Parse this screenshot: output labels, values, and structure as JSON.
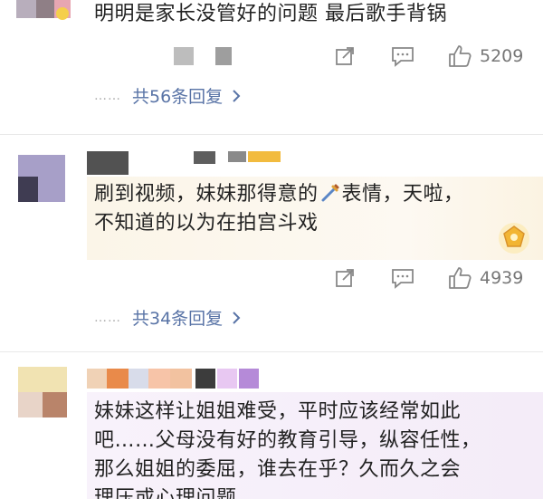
{
  "comments": [
    {
      "text_lines": [
        "明明是家长没管好的问题 最后歌手背锅"
      ],
      "like_count": "5209",
      "replies_label": "共56条回复",
      "replies_dots": "……"
    },
    {
      "text_lines": [
        "刷到视频，妹妹那得意的",
        "表情，天啦，",
        "不知道的以为在拍宫斗戏"
      ],
      "like_count": "4939",
      "replies_label": "共34条回复",
      "replies_dots": "……"
    },
    {
      "text_lines": [
        "妹妹这样让姐姐难受，平时应该经常如此",
        "吧……父母没有好的教育引导，纵容任性，",
        "那么姐姐的委屈，谁去在乎？久而久之会",
        "理压或心理问题……"
      ]
    }
  ],
  "icons": {
    "share": "share-icon",
    "comment": "comment-icon",
    "like": "thumbs-up-icon",
    "chevron": "chevron-right-icon",
    "emoji": "dagger-emoji-icon",
    "badge": "gold-badge-icon"
  },
  "colors": {
    "reply_link": "#5873a6",
    "highlight_bg_2": "#fbf5e8",
    "highlight_bg_3": "#f6eefa"
  }
}
